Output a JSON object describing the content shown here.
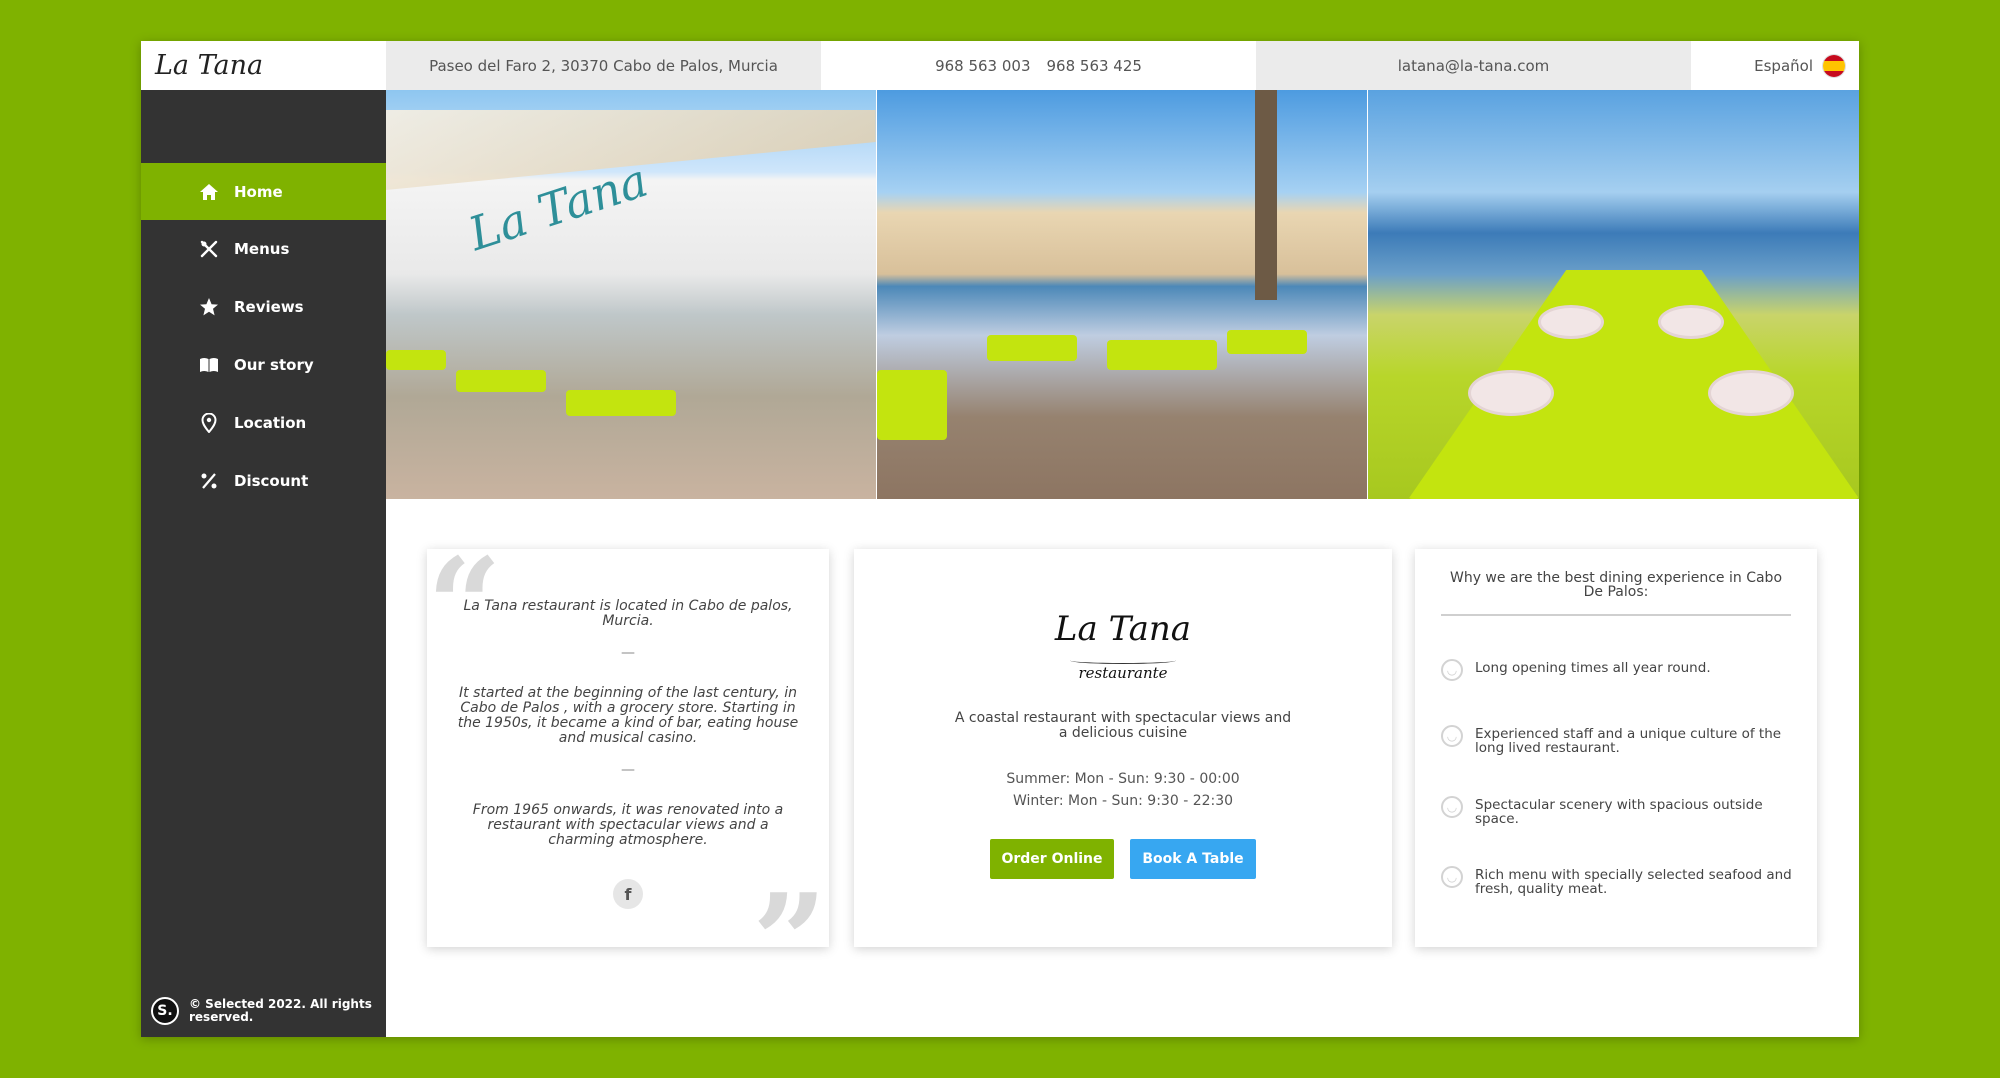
{
  "topbar": {
    "brand": "La Tana",
    "address": "Paseo del Faro 2, 30370 Cabo de Palos, Murcia",
    "phone1": "968 563 003",
    "phone2": "968 563 425",
    "email": "latana@la-tana.com",
    "language": "Español"
  },
  "sidebar": {
    "items": [
      {
        "label": "Home",
        "icon": "home-icon",
        "active": true
      },
      {
        "label": "Menus",
        "icon": "cutlery-icon",
        "active": false
      },
      {
        "label": "Reviews",
        "icon": "star-icon",
        "active": false
      },
      {
        "label": "Our story",
        "icon": "book-icon",
        "active": false
      },
      {
        "label": "Location",
        "icon": "map-pin-icon",
        "active": false
      },
      {
        "label": "Discount",
        "icon": "percent-icon",
        "active": false
      }
    ],
    "footer_logo": "S.",
    "footer_brand": "© Selected",
    "footer_text": " 2022. All rights reserved."
  },
  "hero": {
    "photo_sign_text": "La Tana"
  },
  "story": {
    "p1": "La Tana restaurant is located in Cabo de palos, Murcia.",
    "p2": "It started at the beginning of the last century, in Cabo de Palos , with a grocery store. Starting in the 1950s, it became a kind of bar, eating house and musical casino.",
    "p3": "From 1965 onwards, it was renovated into a restaurant with spectacular views and a charming atmosphere.",
    "separator": "—",
    "facebook": "f"
  },
  "info": {
    "logo_name": "La Tana",
    "logo_sub": "restaurante",
    "tagline": "A coastal restaurant with spectacular views and a delicious cuisine",
    "summer_hours": "Summer: Mon - Sun: 9:30 - 00:00",
    "winter_hours": "Winter: Mon - Sun: 9:30 - 22:30",
    "order_label": "Order Online",
    "book_label": "Book A Table"
  },
  "why": {
    "title": "Why we are the best dining experience in Cabo De Palos:",
    "items": [
      "Long opening times all year round.",
      "Experienced staff and a unique culture of the long lived restaurant.",
      "Spectacular scenery with spacious outside space.",
      "Rich menu with specially selected seafood and fresh, quality meat."
    ]
  },
  "colors": {
    "accent": "#7fb200",
    "sidebar": "#333333",
    "book_button": "#37a7f1"
  }
}
